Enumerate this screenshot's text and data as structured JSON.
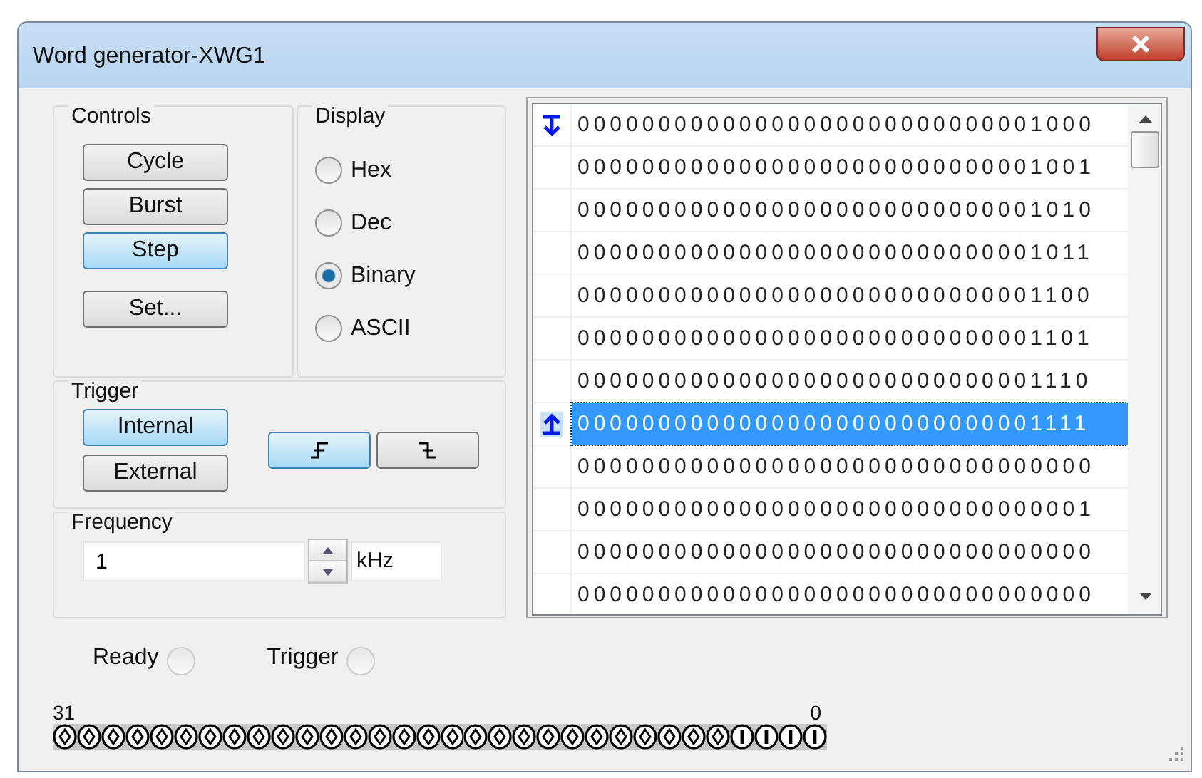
{
  "window": {
    "title": "Word generator-XWG1"
  },
  "controls": {
    "label": "Controls",
    "buttons": [
      {
        "label": "Cycle",
        "selected": false
      },
      {
        "label": "Burst",
        "selected": false
      },
      {
        "label": "Step",
        "selected": true
      },
      {
        "label": "Set...",
        "selected": false
      }
    ]
  },
  "display": {
    "label": "Display",
    "options": [
      {
        "label": "Hex",
        "selected": false
      },
      {
        "label": "Dec",
        "selected": false
      },
      {
        "label": "Binary",
        "selected": true
      },
      {
        "label": "ASCII",
        "selected": false
      }
    ]
  },
  "trigger": {
    "label": "Trigger",
    "sources": [
      {
        "label": "Internal",
        "selected": true
      },
      {
        "label": "External",
        "selected": false
      }
    ],
    "edges": [
      {
        "kind": "rising",
        "selected": true
      },
      {
        "kind": "falling",
        "selected": false
      }
    ]
  },
  "frequency": {
    "label": "Frequency",
    "value": "1",
    "unit": "kHz"
  },
  "words": [
    {
      "value": "00000000000000000000000000001000",
      "selected": false,
      "kind": "start"
    },
    {
      "value": "00000000000000000000000000001001",
      "selected": false
    },
    {
      "value": "00000000000000000000000000001010",
      "selected": false
    },
    {
      "value": "00000000000000000000000000001011",
      "selected": false
    },
    {
      "value": "00000000000000000000000000001100",
      "selected": false
    },
    {
      "value": "00000000000000000000000000001101",
      "selected": false
    },
    {
      "value": "00000000000000000000000000001110",
      "selected": false
    },
    {
      "value": "00000000000000000000000000001111",
      "selected": true,
      "kind": "end"
    },
    {
      "value": "00000000000000000000000000000000",
      "selected": false
    },
    {
      "value": "00000000000000000000000000000001",
      "selected": false
    },
    {
      "value": "00000000000000000000000000000000",
      "selected": false
    },
    {
      "value": "00000000000000000000000000000000",
      "selected": false
    }
  ],
  "indicators": [
    {
      "label": "Ready",
      "on": false
    },
    {
      "label": "Trigger",
      "on": false
    }
  ],
  "bits": {
    "high_label": "31",
    "low_label": "0",
    "values": [
      {
        "on": false
      },
      {
        "on": false
      },
      {
        "on": false
      },
      {
        "on": false
      },
      {
        "on": false
      },
      {
        "on": false
      },
      {
        "on": false
      },
      {
        "on": false
      },
      {
        "on": false
      },
      {
        "on": false
      },
      {
        "on": false
      },
      {
        "on": false
      },
      {
        "on": false
      },
      {
        "on": false
      },
      {
        "on": false
      },
      {
        "on": false
      },
      {
        "on": false
      },
      {
        "on": false
      },
      {
        "on": false
      },
      {
        "on": false
      },
      {
        "on": false
      },
      {
        "on": false
      },
      {
        "on": false
      },
      {
        "on": false
      },
      {
        "on": false
      },
      {
        "on": false
      },
      {
        "on": false
      },
      {
        "on": false
      },
      {
        "on": true
      },
      {
        "on": true
      },
      {
        "on": true
      },
      {
        "on": true
      }
    ]
  }
}
